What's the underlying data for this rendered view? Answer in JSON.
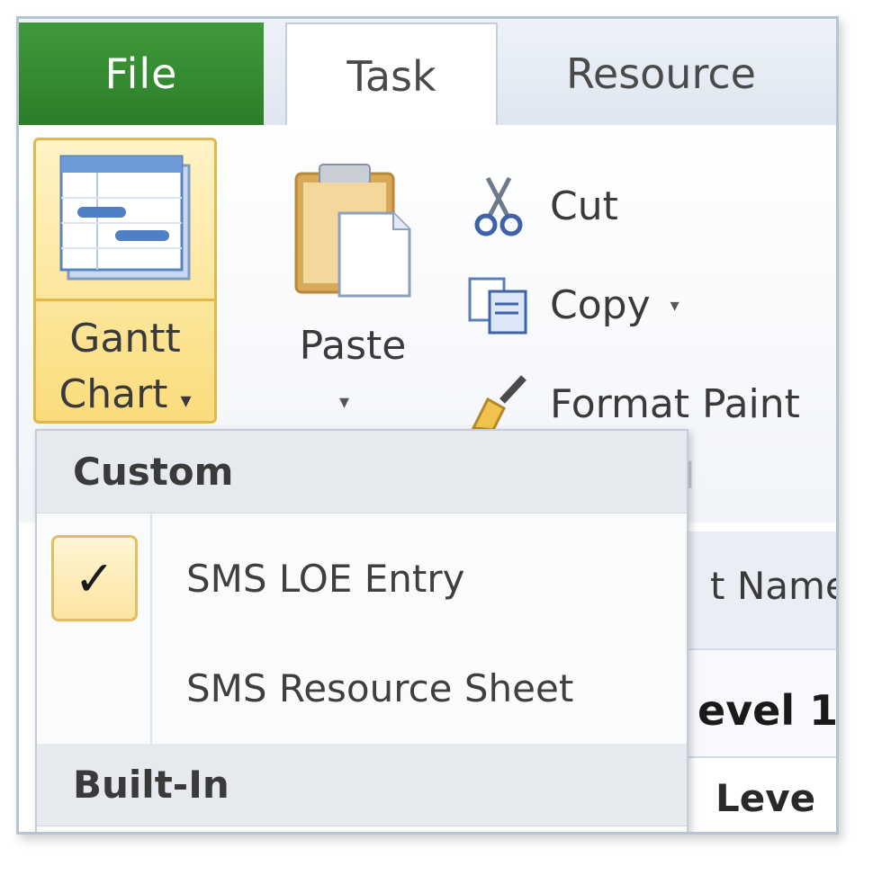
{
  "tabs": {
    "file": "File",
    "task": "Task",
    "resource": "Resource"
  },
  "ribbon": {
    "gantt_label_line1": "Gantt",
    "gantt_label_line2": "Chart",
    "gantt_arrow": "▾",
    "paste_label": "Paste",
    "paste_arrow": "▾",
    "cut_label": "Cut",
    "copy_label": "Copy",
    "copy_arrow": "▾",
    "format_painter_label": "Format Paint",
    "group_fragment": "l"
  },
  "dropdown": {
    "custom_header": "Custom",
    "items": [
      {
        "label": "SMS LOE Entry",
        "checked": true,
        "check_glyph": "✓"
      },
      {
        "label": "SMS Resource Sheet",
        "checked": false
      }
    ],
    "builtin_header": "Built-In"
  },
  "sheet": {
    "header_fragment": "t Name",
    "row1_fragment": "evel 1",
    "row2_fragment": "Leve"
  },
  "colors": {
    "file_tab": "#2f8a2c",
    "highlight": "#fbdc7c",
    "highlight_border": "#e2b84a"
  }
}
